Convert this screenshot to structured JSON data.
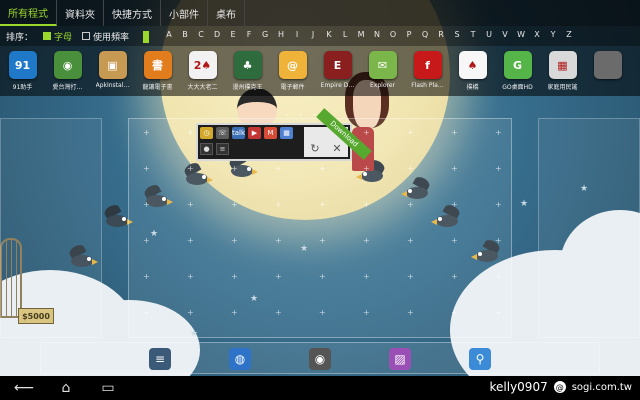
{
  "tabs": [
    {
      "label": "所有程式",
      "active": true
    },
    {
      "label": "資料夾",
      "active": false
    },
    {
      "label": "快捷方式",
      "active": false
    },
    {
      "label": "小部件",
      "active": false
    },
    {
      "label": "桌布",
      "active": false
    }
  ],
  "sort": {
    "label": "排序：",
    "options": [
      {
        "label": "字母",
        "selected": true
      },
      {
        "label": "使用頻率",
        "selected": false
      }
    ]
  },
  "alphabet": [
    "A",
    "B",
    "C",
    "D",
    "E",
    "F",
    "G",
    "H",
    "I",
    "J",
    "K",
    "L",
    "M",
    "N",
    "O",
    "P",
    "Q",
    "R",
    "S",
    "T",
    "U",
    "V",
    "W",
    "X",
    "Y",
    "Z"
  ],
  "apps": [
    {
      "label": "91助手",
      "icon": "91-icon",
      "color": "#1f78c8",
      "glyph": "91"
    },
    {
      "label": "愛台灣打…",
      "icon": "game-icon",
      "color": "#4a8f3b",
      "glyph": "◉"
    },
    {
      "label": "ApkInstal…",
      "icon": "package-icon",
      "color": "#c69a52",
      "glyph": "▣"
    },
    {
      "label": "龍讓電子書",
      "icon": "book-icon",
      "color": "#e27d1e",
      "glyph": "書"
    },
    {
      "label": "大大大老二",
      "icon": "cards-icon",
      "color": "#f2f2f2",
      "glyph": "2♠"
    },
    {
      "label": "漫州撲克王",
      "icon": "poker-icon",
      "color": "#2e6b3d",
      "glyph": "♣"
    },
    {
      "label": "電子郵件",
      "icon": "email-icon",
      "color": "#f0b33a",
      "glyph": "@"
    },
    {
      "label": "Empire D…",
      "icon": "empire-icon",
      "color": "#8a1f1f",
      "glyph": "E"
    },
    {
      "label": "Explorer",
      "icon": "explorer-icon",
      "color": "#7bb64a",
      "glyph": "✉"
    },
    {
      "label": "Flash Pla…",
      "icon": "flash-icon",
      "color": "#c7181a",
      "glyph": "f"
    },
    {
      "label": "撲橋",
      "icon": "bridge-icon",
      "color": "#f7f7f7",
      "glyph": "♠"
    },
    {
      "label": "GO桌面HD",
      "icon": "go-launcher-icon",
      "color": "#55b548",
      "glyph": "G"
    },
    {
      "label": "家庭用民謠",
      "icon": "calendar-icon",
      "color": "#d9d9d9",
      "glyph": "▦"
    },
    {
      "label": "",
      "icon": "partial-icon",
      "color": "#6b6b6b",
      "glyph": ""
    }
  ],
  "widget": {
    "icons": [
      {
        "name": "clock-widget-icon",
        "glyph": "◷",
        "color": "#d3a82a"
      },
      {
        "name": "phone-widget-icon",
        "glyph": "☏",
        "color": "#5c5c5c"
      },
      {
        "name": "talk-widget-icon",
        "glyph": "talk",
        "color": "#3a6fb4"
      },
      {
        "name": "ad-widget-icon",
        "glyph": "▶",
        "color": "#c43535"
      },
      {
        "name": "gmail-widget-icon",
        "glyph": "M",
        "color": "#d84b36"
      },
      {
        "name": "calendar-widget-icon",
        "glyph": "▦",
        "color": "#4f7fd0"
      }
    ],
    "download_label": "Download"
  },
  "dock": [
    {
      "name": "settings-icon",
      "glyph": "≡",
      "color": "#3a5a78"
    },
    {
      "name": "browser-globe-icon",
      "glyph": "◍",
      "color": "#2f73c8"
    },
    {
      "name": "camera-icon",
      "glyph": "◉",
      "color": "#555555"
    },
    {
      "name": "gallery-icon",
      "glyph": "▨",
      "color": "#9a4fb5"
    },
    {
      "name": "search-icon",
      "glyph": "⚲",
      "color": "#3c8bd6"
    }
  ],
  "sign_text": "$5000",
  "watermark": {
    "user": "kelly0907",
    "site": "sogi.com.tw"
  },
  "nav": {
    "back": "⟵",
    "home": "⌂",
    "recent": "▭"
  }
}
